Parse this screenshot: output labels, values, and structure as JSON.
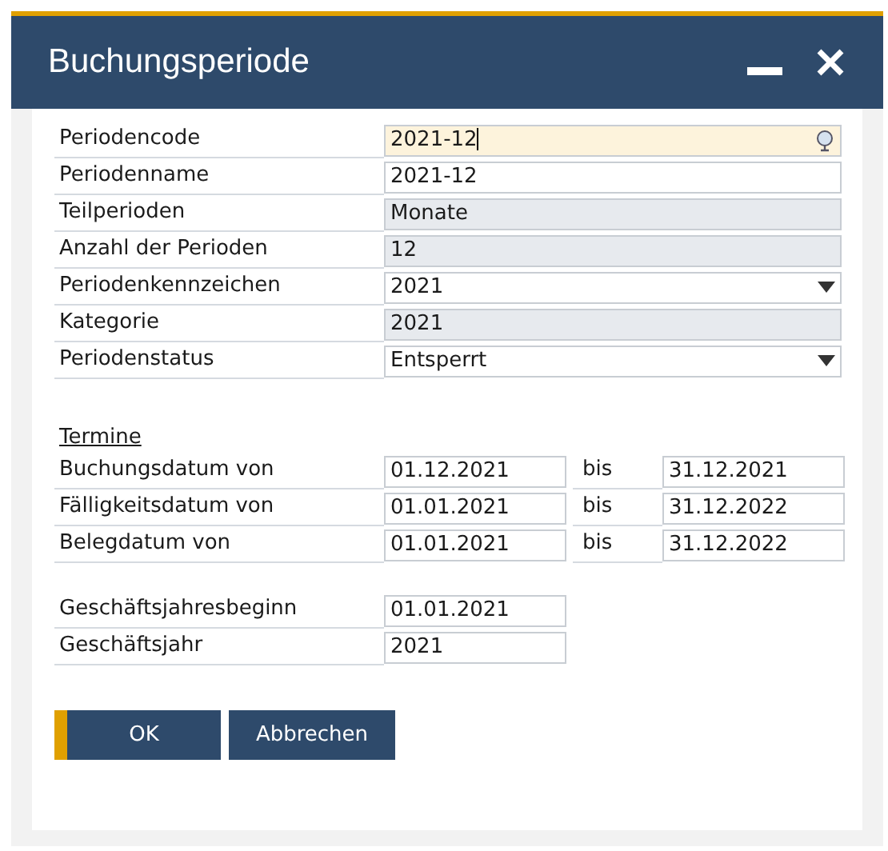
{
  "window": {
    "title": "Buchungsperiode"
  },
  "fields": [
    {
      "label": "Periodencode",
      "value": "2021-12",
      "kind": "lookup",
      "focused": true
    },
    {
      "label": "Periodenname",
      "value": "2021-12",
      "kind": "text",
      "focused": false
    },
    {
      "label": "Teilperioden",
      "value": "Monate",
      "kind": "readonly",
      "focused": false
    },
    {
      "label": "Anzahl der Perioden",
      "value": "12",
      "kind": "readonly",
      "focused": false
    },
    {
      "label": "Periodenkennzeichen",
      "value": "2021",
      "kind": "dropdown",
      "focused": false
    },
    {
      "label": "Kategorie",
      "value": "2021",
      "kind": "readonly",
      "focused": false
    },
    {
      "label": "Periodenstatus",
      "value": "Entsperrt",
      "kind": "dropdown",
      "focused": false
    }
  ],
  "dates": {
    "heading": "Termine",
    "rows": [
      {
        "label": "Buchungsdatum von",
        "from": "01.12.2021",
        "separator": "bis",
        "to": "31.12.2021"
      },
      {
        "label": "Fälligkeitsdatum von",
        "from": "01.01.2021",
        "separator": "bis",
        "to": "31.12.2022"
      },
      {
        "label": "Belegdatum von",
        "from": "01.01.2021",
        "separator": "bis",
        "to": "31.12.2022"
      }
    ]
  },
  "fiscal": [
    {
      "label": "Geschäftsjahresbeginn",
      "value": "01.01.2021"
    },
    {
      "label": "Geschäftsjahr",
      "value": "2021"
    }
  ],
  "buttons": [
    {
      "label": "OK",
      "default": true
    },
    {
      "label": "Abbrechen",
      "default": false
    }
  ]
}
